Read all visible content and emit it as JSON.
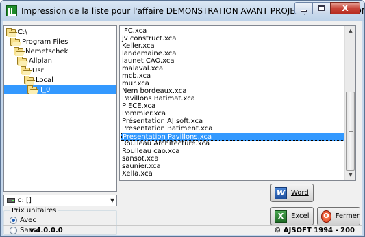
{
  "window": {
    "title": "Impression de la liste pour l'affaire DEMONSTRATION AVANT PROJET (bible PAVILLONS)",
    "close_label": "X"
  },
  "tree": {
    "items": [
      {
        "label": "C:\\",
        "level": 0
      },
      {
        "label": "Program Files",
        "level": 1
      },
      {
        "label": "Nemetschek",
        "level": 2
      },
      {
        "label": "Allplan",
        "level": 3
      },
      {
        "label": "Usr",
        "level": 4
      },
      {
        "label": "Local",
        "level": 5
      },
      {
        "label": "I_0",
        "level": 6,
        "selected": true
      }
    ]
  },
  "drive": {
    "value": "c: []"
  },
  "pricing": {
    "title": "Prix unitaires",
    "options": [
      {
        "label": "Avec",
        "checked": true
      },
      {
        "label": "Sans",
        "checked": false
      }
    ]
  },
  "files": {
    "items": [
      "IFC.xca",
      "jv construct.xca",
      "Keller.xca",
      "landemaine.xca",
      "launet CAO.xca",
      "malaval.xca",
      "mcb.xca",
      "mur.xca",
      "Nem bordeaux.xca",
      "Pavillons Batimat.xca",
      "PIECE.xca",
      "Pommier.xca",
      "Présentation AJ soft.xca",
      "Presentation Batiment.xca",
      "Presentation Pavillons.xca",
      "Roulleau Architecture.xca",
      "Roulleau cao.xca",
      "sansot.xca",
      "saunier.xca",
      "Xella.xca"
    ],
    "selected_index": 14
  },
  "buttons": {
    "word": "Word",
    "word_icon_glyph": "W",
    "excel": "Excel",
    "excel_icon_glyph": "X",
    "close": "Fermer",
    "close_icon_glyph": "O"
  },
  "status": {
    "version": "v.4.0.0.0",
    "copyright": "© AJSOFT 1994 - 200"
  }
}
